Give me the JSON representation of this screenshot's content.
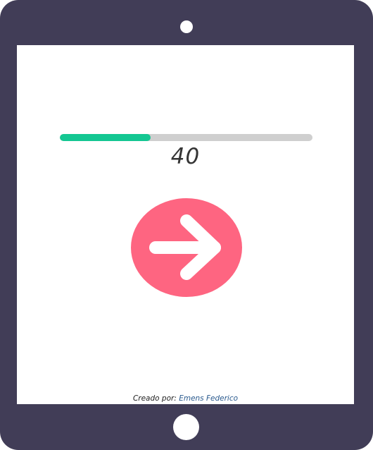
{
  "device": {
    "frame_color": "#413d57",
    "camera_icon": "camera-dot-icon",
    "home_button_icon": "home-circle-icon"
  },
  "progress": {
    "value_fraction": 0.36,
    "fill_color": "#14c792",
    "track_color": "#cfcfcf"
  },
  "counter": {
    "value": "40"
  },
  "next_button": {
    "icon": "arrow-right-icon",
    "color": "#fe6581"
  },
  "footer": {
    "prefix": "Creado por:",
    "author": "Emens Federico"
  }
}
